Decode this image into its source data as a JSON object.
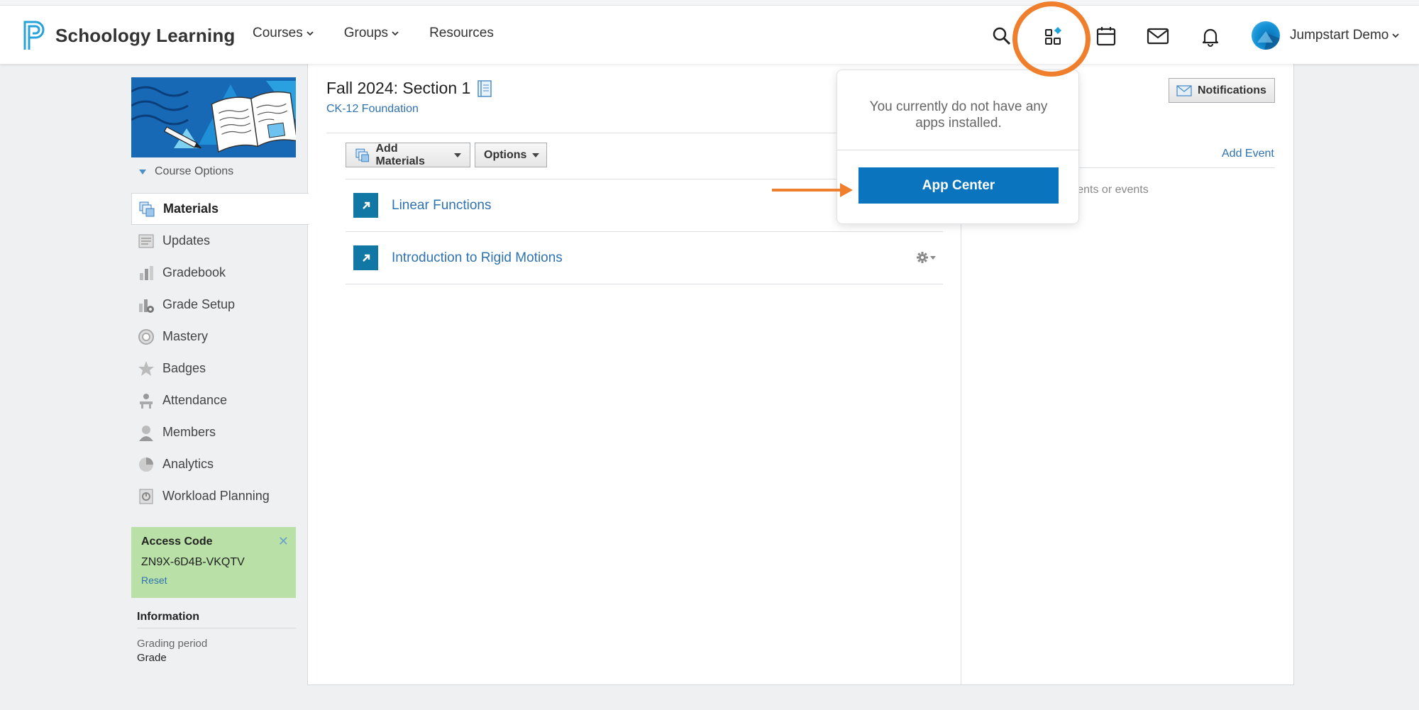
{
  "header": {
    "logo_text": "Schoology Learning",
    "nav": [
      {
        "label": "Courses"
      },
      {
        "label": "Groups"
      },
      {
        "label": "Resources"
      }
    ],
    "icons": [
      "search-icon",
      "apps-icon",
      "calendar-icon",
      "mail-icon",
      "bell-icon"
    ],
    "user_name": "Jumpstart Demo",
    "accent_color": "#ef7f2c"
  },
  "apps_popover": {
    "message": "You currently do not have any apps installed.",
    "button_label": "App Center",
    "button_color": "#0b74bf"
  },
  "course": {
    "title": "Fall 2024: Section 1",
    "subtitle": "CK-12 Foundation",
    "options_label": "Course Options"
  },
  "sidebar": {
    "items": [
      {
        "label": "Materials",
        "icon": "materials-icon",
        "active": true
      },
      {
        "label": "Updates",
        "icon": "updates-icon"
      },
      {
        "label": "Gradebook",
        "icon": "gradebook-icon"
      },
      {
        "label": "Grade Setup",
        "icon": "grade-setup-icon"
      },
      {
        "label": "Mastery",
        "icon": "mastery-icon"
      },
      {
        "label": "Badges",
        "icon": "badges-icon"
      },
      {
        "label": "Attendance",
        "icon": "attendance-icon"
      },
      {
        "label": "Members",
        "icon": "members-icon"
      },
      {
        "label": "Analytics",
        "icon": "analytics-icon"
      },
      {
        "label": "Workload Planning",
        "icon": "workload-icon"
      }
    ]
  },
  "access_code": {
    "title": "Access Code",
    "code": "ZN9X-6D4B-VKQTV",
    "reset_label": "Reset"
  },
  "information": {
    "title": "Information",
    "line1": "Grading period",
    "line2": "Grade"
  },
  "toolbar": {
    "add_materials_label": "Add Materials",
    "options_label": "Options"
  },
  "materials": [
    {
      "title": "Linear Functions"
    },
    {
      "title": "Introduction to Rigid Motions"
    }
  ],
  "right_column": {
    "notifications_label": "Notifications",
    "add_event_label": "Add Event",
    "events_text": "nments or events"
  }
}
